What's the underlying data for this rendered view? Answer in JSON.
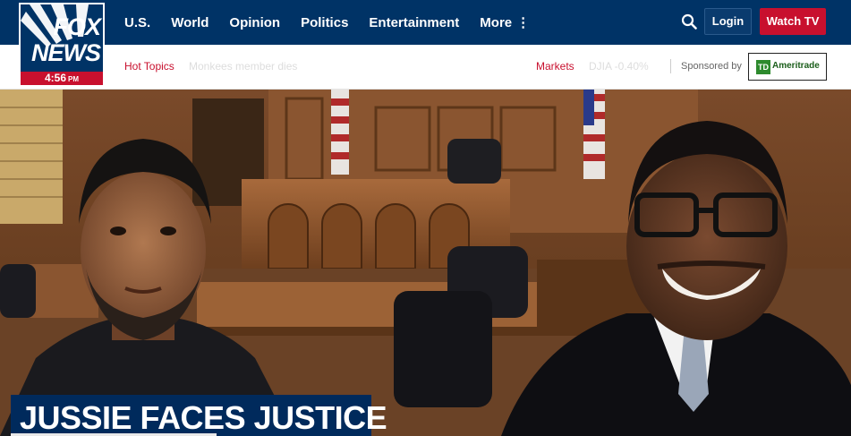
{
  "brand": {
    "line1": "FOX",
    "line2": "NEWS",
    "time": "4:56",
    "ampm": "PM"
  },
  "nav": {
    "items": [
      {
        "label": "U.S."
      },
      {
        "label": "World"
      },
      {
        "label": "Opinion"
      },
      {
        "label": "Politics"
      },
      {
        "label": "Entertainment"
      },
      {
        "label": "More"
      }
    ],
    "more_icon": "vertical-dots-icon",
    "search_icon": "search-icon",
    "login_label": "Login",
    "watch_label": "Watch TV"
  },
  "subbar": {
    "hot_topics_label": "Hot Topics",
    "hot_topics_item": "Monkees member dies",
    "markets_label": "Markets",
    "markets_item": "DJIA -0.40%",
    "sponsored_label": "Sponsored by",
    "sponsor_mark": "TD",
    "sponsor_name": "Ameritrade"
  },
  "hero": {
    "headline": "JUSSIE FACES JUSTICE"
  },
  "colors": {
    "navy": "#003366",
    "red": "#c8102e",
    "headline_bg": "#002a5c"
  }
}
